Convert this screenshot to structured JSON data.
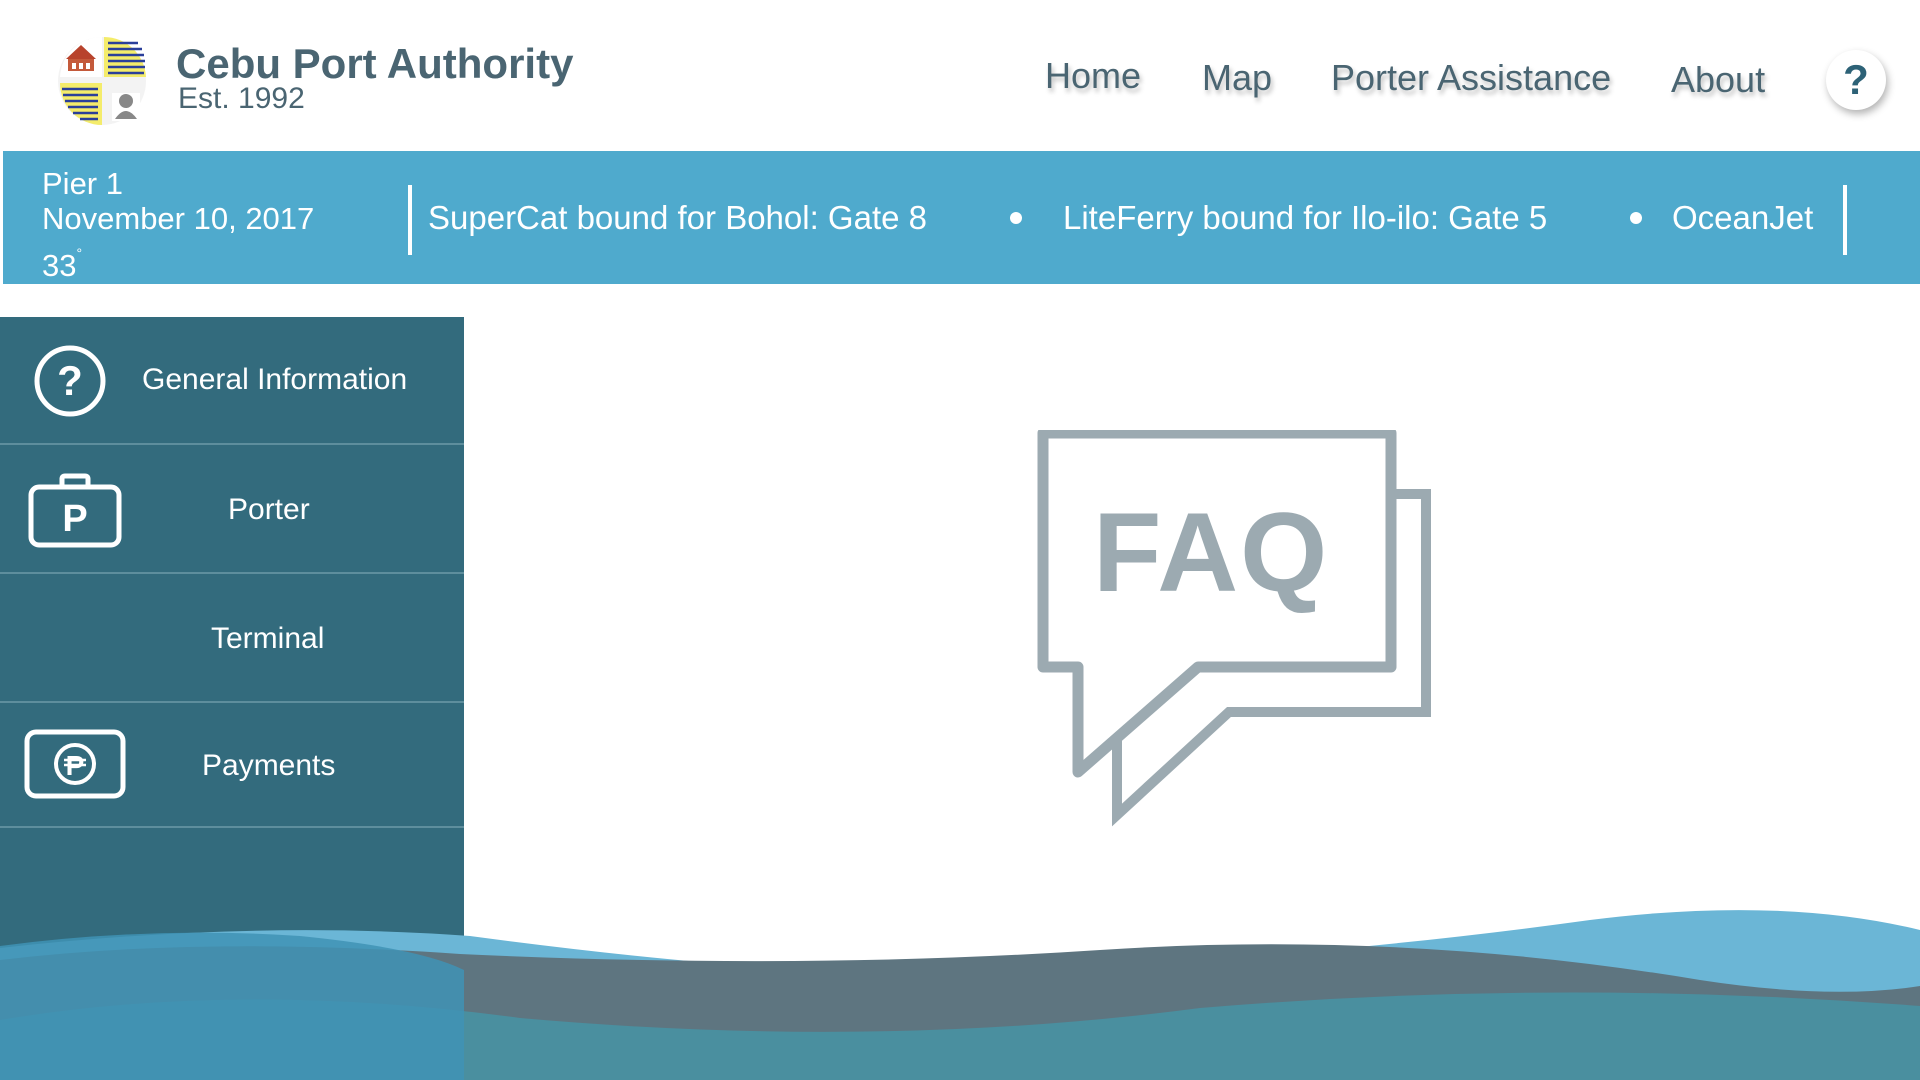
{
  "header": {
    "brand_name": "Cebu Port Authority",
    "brand_sub": "Est. 1992",
    "nav": {
      "home": "Home",
      "map": "Map",
      "porter_assistance": "Porter Assistance",
      "about": "About",
      "help": "?"
    }
  },
  "infobar": {
    "pier": "Pier 1",
    "date": "November 10, 2017",
    "temperature": "33",
    "temperature_unit": "°",
    "ticker": [
      "SuperCat bound for Bohol: Gate 8",
      "LiteFerry bound for Ilo-ilo: Gate 5",
      "OceanJet"
    ]
  },
  "sidebar": {
    "items": [
      {
        "label": "General Information",
        "icon": "question-circle-icon"
      },
      {
        "label": "Porter",
        "icon": "porter-bag-icon"
      },
      {
        "label": "Terminal",
        "icon": ""
      },
      {
        "label": "Payments",
        "icon": "peso-bill-icon"
      }
    ]
  },
  "main": {
    "faq_label": "FAQ"
  },
  "colors": {
    "header_text": "#4a6572",
    "infobar": "#4faacd",
    "sidebar": "#336b7d",
    "faq_gray": "#9caab1",
    "wave_light": "#6bb6d6",
    "wave_dark": "#5e7580",
    "wave_teal": "#4a8f9f"
  }
}
